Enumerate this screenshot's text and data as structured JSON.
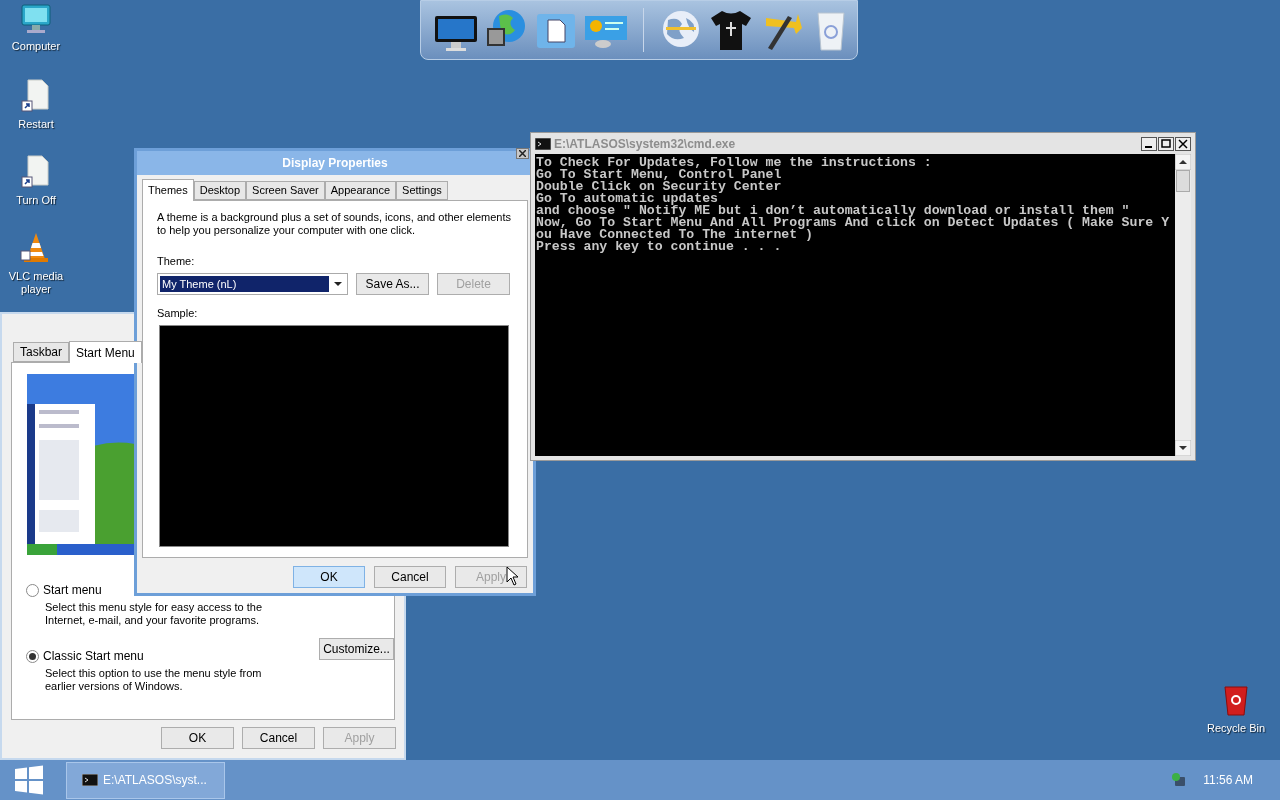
{
  "desktop_icons": [
    {
      "kind": "computer",
      "label": "Computer"
    },
    {
      "kind": "shortcut",
      "label": "Restart"
    },
    {
      "kind": "shortcut",
      "label": "Turn Off"
    },
    {
      "kind": "vlc",
      "label": "VLC media player"
    }
  ],
  "recycle_bin": {
    "label": "Recycle Bin"
  },
  "taskbar_properties": {
    "tabs": [
      {
        "label": "Taskbar",
        "selected": false
      },
      {
        "label": "Start Menu",
        "selected": true
      }
    ],
    "options": [
      {
        "label": "Start menu",
        "description": "Select this menu style for easy access to the Internet, e-mail, and your favorite programs.",
        "selected": false
      },
      {
        "label": "Classic Start menu",
        "description": "Select this option to use the menu style from earlier versions of Windows.",
        "selected": true,
        "button": "Customize..."
      }
    ],
    "buttons": [
      {
        "label": "OK",
        "disabled": false
      },
      {
        "label": "Cancel",
        "disabled": false
      },
      {
        "label": "Apply",
        "disabled": true
      }
    ]
  },
  "display_properties": {
    "title": "Display Properties",
    "tabs": [
      {
        "label": "Themes",
        "selected": true
      },
      {
        "label": "Desktop",
        "selected": false
      },
      {
        "label": "Screen Saver",
        "selected": false
      },
      {
        "label": "Appearance",
        "selected": false
      },
      {
        "label": "Settings",
        "selected": false
      }
    ],
    "description": "A theme is a background plus a set of sounds, icons, and other elements to help you personalize your computer with one click.",
    "theme_label": "Theme:",
    "theme_value": "My Theme (nL)",
    "theme_buttons": [
      {
        "label": "Save As...",
        "disabled": false
      },
      {
        "label": "Delete",
        "disabled": true
      }
    ],
    "sample_label": "Sample:",
    "buttons": [
      {
        "label": "OK",
        "disabled": false,
        "focused": true
      },
      {
        "label": "Cancel",
        "disabled": false,
        "focused": false
      },
      {
        "label": "Apply",
        "disabled": true,
        "focused": false
      }
    ]
  },
  "console": {
    "title": "E:\\ATLASOS\\system32\\cmd.exe",
    "lines": [
      "To Check For Updates, Follow me the instructions :",
      "Go To Start Menu, Control Panel",
      "Double Click on Security Center",
      "Go To automatic updates",
      "and choose \" Notify ME but i don’t automatically download or install them \"",
      "Now, Go To Start Menu And All Programs And click on Detect Updates ( Make Sure Y",
      "ou Have Connected To The internet )",
      "Press any key to continue . . ."
    ]
  },
  "taskbar": {
    "tasks": [
      {
        "label": "E:\\ATLASOS\\syst...",
        "selected": true
      }
    ],
    "clock": "11:56 AM"
  }
}
